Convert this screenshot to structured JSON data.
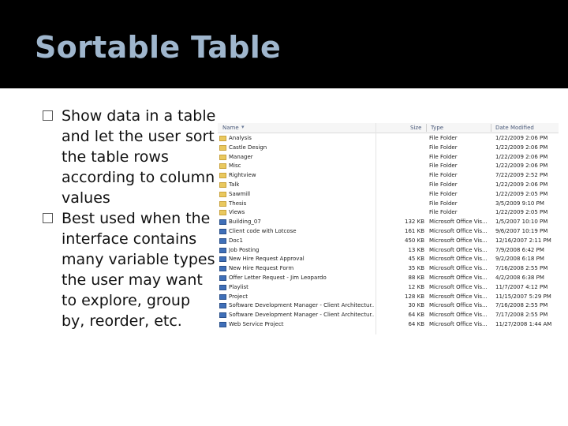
{
  "slide": {
    "title": "Sortable Table",
    "bullets": [
      "Show data in a table and let the user sort the table rows according to column values",
      "Best used when the interface contains many variable types the user may want to explore, group by, reorder, etc."
    ]
  },
  "explorer": {
    "columns": {
      "name": "Name",
      "size": "Size",
      "type": "Type",
      "date": "Date Modified"
    },
    "rows": [
      {
        "name": "Analysis",
        "size": "",
        "type": "File Folder",
        "date": "1/22/2009 2:06 PM",
        "icon": "folder-icon"
      },
      {
        "name": "Castle Design",
        "size": "",
        "type": "File Folder",
        "date": "1/22/2009 2:06 PM",
        "icon": "folder-icon"
      },
      {
        "name": "Manager",
        "size": "",
        "type": "File Folder",
        "date": "1/22/2009 2:06 PM",
        "icon": "folder-icon"
      },
      {
        "name": "Misc",
        "size": "",
        "type": "File Folder",
        "date": "1/22/2009 2:06 PM",
        "icon": "folder-icon"
      },
      {
        "name": "Rightview",
        "size": "",
        "type": "File Folder",
        "date": "7/22/2009 2:52 PM",
        "icon": "folder-icon"
      },
      {
        "name": "Talk",
        "size": "",
        "type": "File Folder",
        "date": "1/22/2009 2:06 PM",
        "icon": "folder-icon"
      },
      {
        "name": "Sawmill",
        "size": "",
        "type": "File Folder",
        "date": "1/22/2009 2:05 PM",
        "icon": "folder-icon"
      },
      {
        "name": "Thesis",
        "size": "",
        "type": "File Folder",
        "date": "3/5/2009 9:10 PM",
        "icon": "folder-icon"
      },
      {
        "name": "Views",
        "size": "",
        "type": "File Folder",
        "date": "1/22/2009 2:05 PM",
        "icon": "folder-icon"
      },
      {
        "name": "Building_07",
        "size": "132 KB",
        "type": "Microsoft Office Vis...",
        "date": "1/5/2007 10:10 PM",
        "icon": "document-icon"
      },
      {
        "name": "Client code with Lotcose",
        "size": "161 KB",
        "type": "Microsoft Office Vis...",
        "date": "9/6/2007 10:19 PM",
        "icon": "document-icon"
      },
      {
        "name": "Doc1",
        "size": "450 KB",
        "type": "Microsoft Office Vis...",
        "date": "12/16/2007 2:11 PM",
        "icon": "document-icon"
      },
      {
        "name": "Job Posting",
        "size": "13 KB",
        "type": "Microsoft Office Vis...",
        "date": "7/9/2008 6:42 PM",
        "icon": "document-icon"
      },
      {
        "name": "New Hire Request Approval",
        "size": "45 KB",
        "type": "Microsoft Office Vis...",
        "date": "9/2/2008 6:18 PM",
        "icon": "document-icon"
      },
      {
        "name": "New Hire Request Form",
        "size": "35 KB",
        "type": "Microsoft Office Vis...",
        "date": "7/16/2008 2:55 PM",
        "icon": "document-icon"
      },
      {
        "name": "Offer Letter Request - Jim Leopardo",
        "size": "88 KB",
        "type": "Microsoft Office Vis...",
        "date": "4/2/2008 6:38 PM",
        "icon": "document-icon"
      },
      {
        "name": "Playlist",
        "size": "12 KB",
        "type": "Microsoft Office Vis...",
        "date": "11/7/2007 4:12 PM",
        "icon": "document-icon"
      },
      {
        "name": "Project",
        "size": "128 KB",
        "type": "Microsoft Office Vis...",
        "date": "11/15/2007 5:29 PM",
        "icon": "document-icon"
      },
      {
        "name": "Software Development Manager - Client Architectur...",
        "size": "30 KB",
        "type": "Microsoft Office Vis...",
        "date": "7/16/2008 2:55 PM",
        "icon": "document-icon"
      },
      {
        "name": "Software Development Manager - Client Architectur...",
        "size": "64 KB",
        "type": "Microsoft Office Vis...",
        "date": "7/17/2008 2:55 PM",
        "icon": "document-icon"
      },
      {
        "name": "Web Service Project",
        "size": "64 KB",
        "type": "Microsoft Office Vis...",
        "date": "11/27/2008 1:44 AM",
        "icon": "document-icon"
      }
    ]
  }
}
